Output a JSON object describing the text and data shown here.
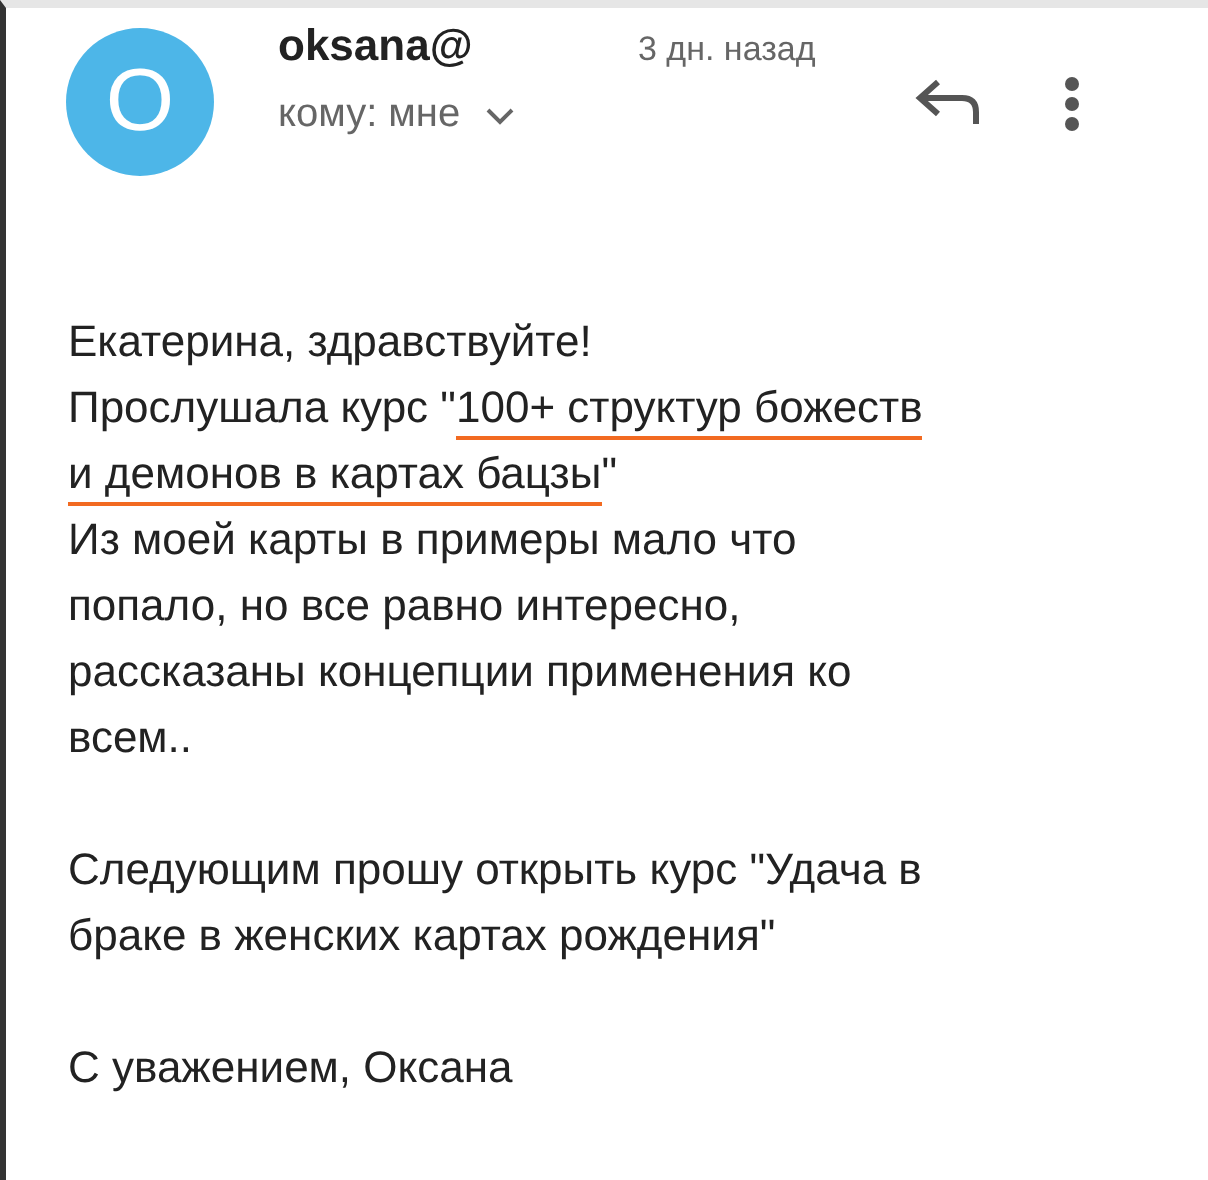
{
  "header": {
    "avatar_letter": "O",
    "sender": "oksana@",
    "time": "3 дн. назад",
    "recipient": "кому: мне"
  },
  "body": [
    [
      [
        {
          "text": "Екатерина, здравствуйте!",
          "underlined": false
        }
      ],
      [
        {
          "text": "Прослушала курс \"",
          "underlined": false
        },
        {
          "text": "100+ структур божеств",
          "underlined": true
        }
      ],
      [
        {
          "text": "и демонов в картах бацзы",
          "underlined": true
        },
        {
          "text": "\"",
          "underlined": false
        }
      ],
      [
        {
          "text": "Из моей карты в примеры мало что",
          "underlined": false
        }
      ],
      [
        {
          "text": "попало, но все равно интересно,",
          "underlined": false
        }
      ],
      [
        {
          "text": "рассказаны концепции применения ко",
          "underlined": false
        }
      ],
      [
        {
          "text": "всем..",
          "underlined": false
        }
      ]
    ],
    [
      [
        {
          "text": "Следующим прошу открыть курс \"Удача в",
          "underlined": false
        }
      ],
      [
        {
          "text": "браке в женских картах рождения\"",
          "underlined": false
        }
      ]
    ],
    [
      [
        {
          "text": "С уважением, Оксана",
          "underlined": false
        }
      ]
    ]
  ]
}
